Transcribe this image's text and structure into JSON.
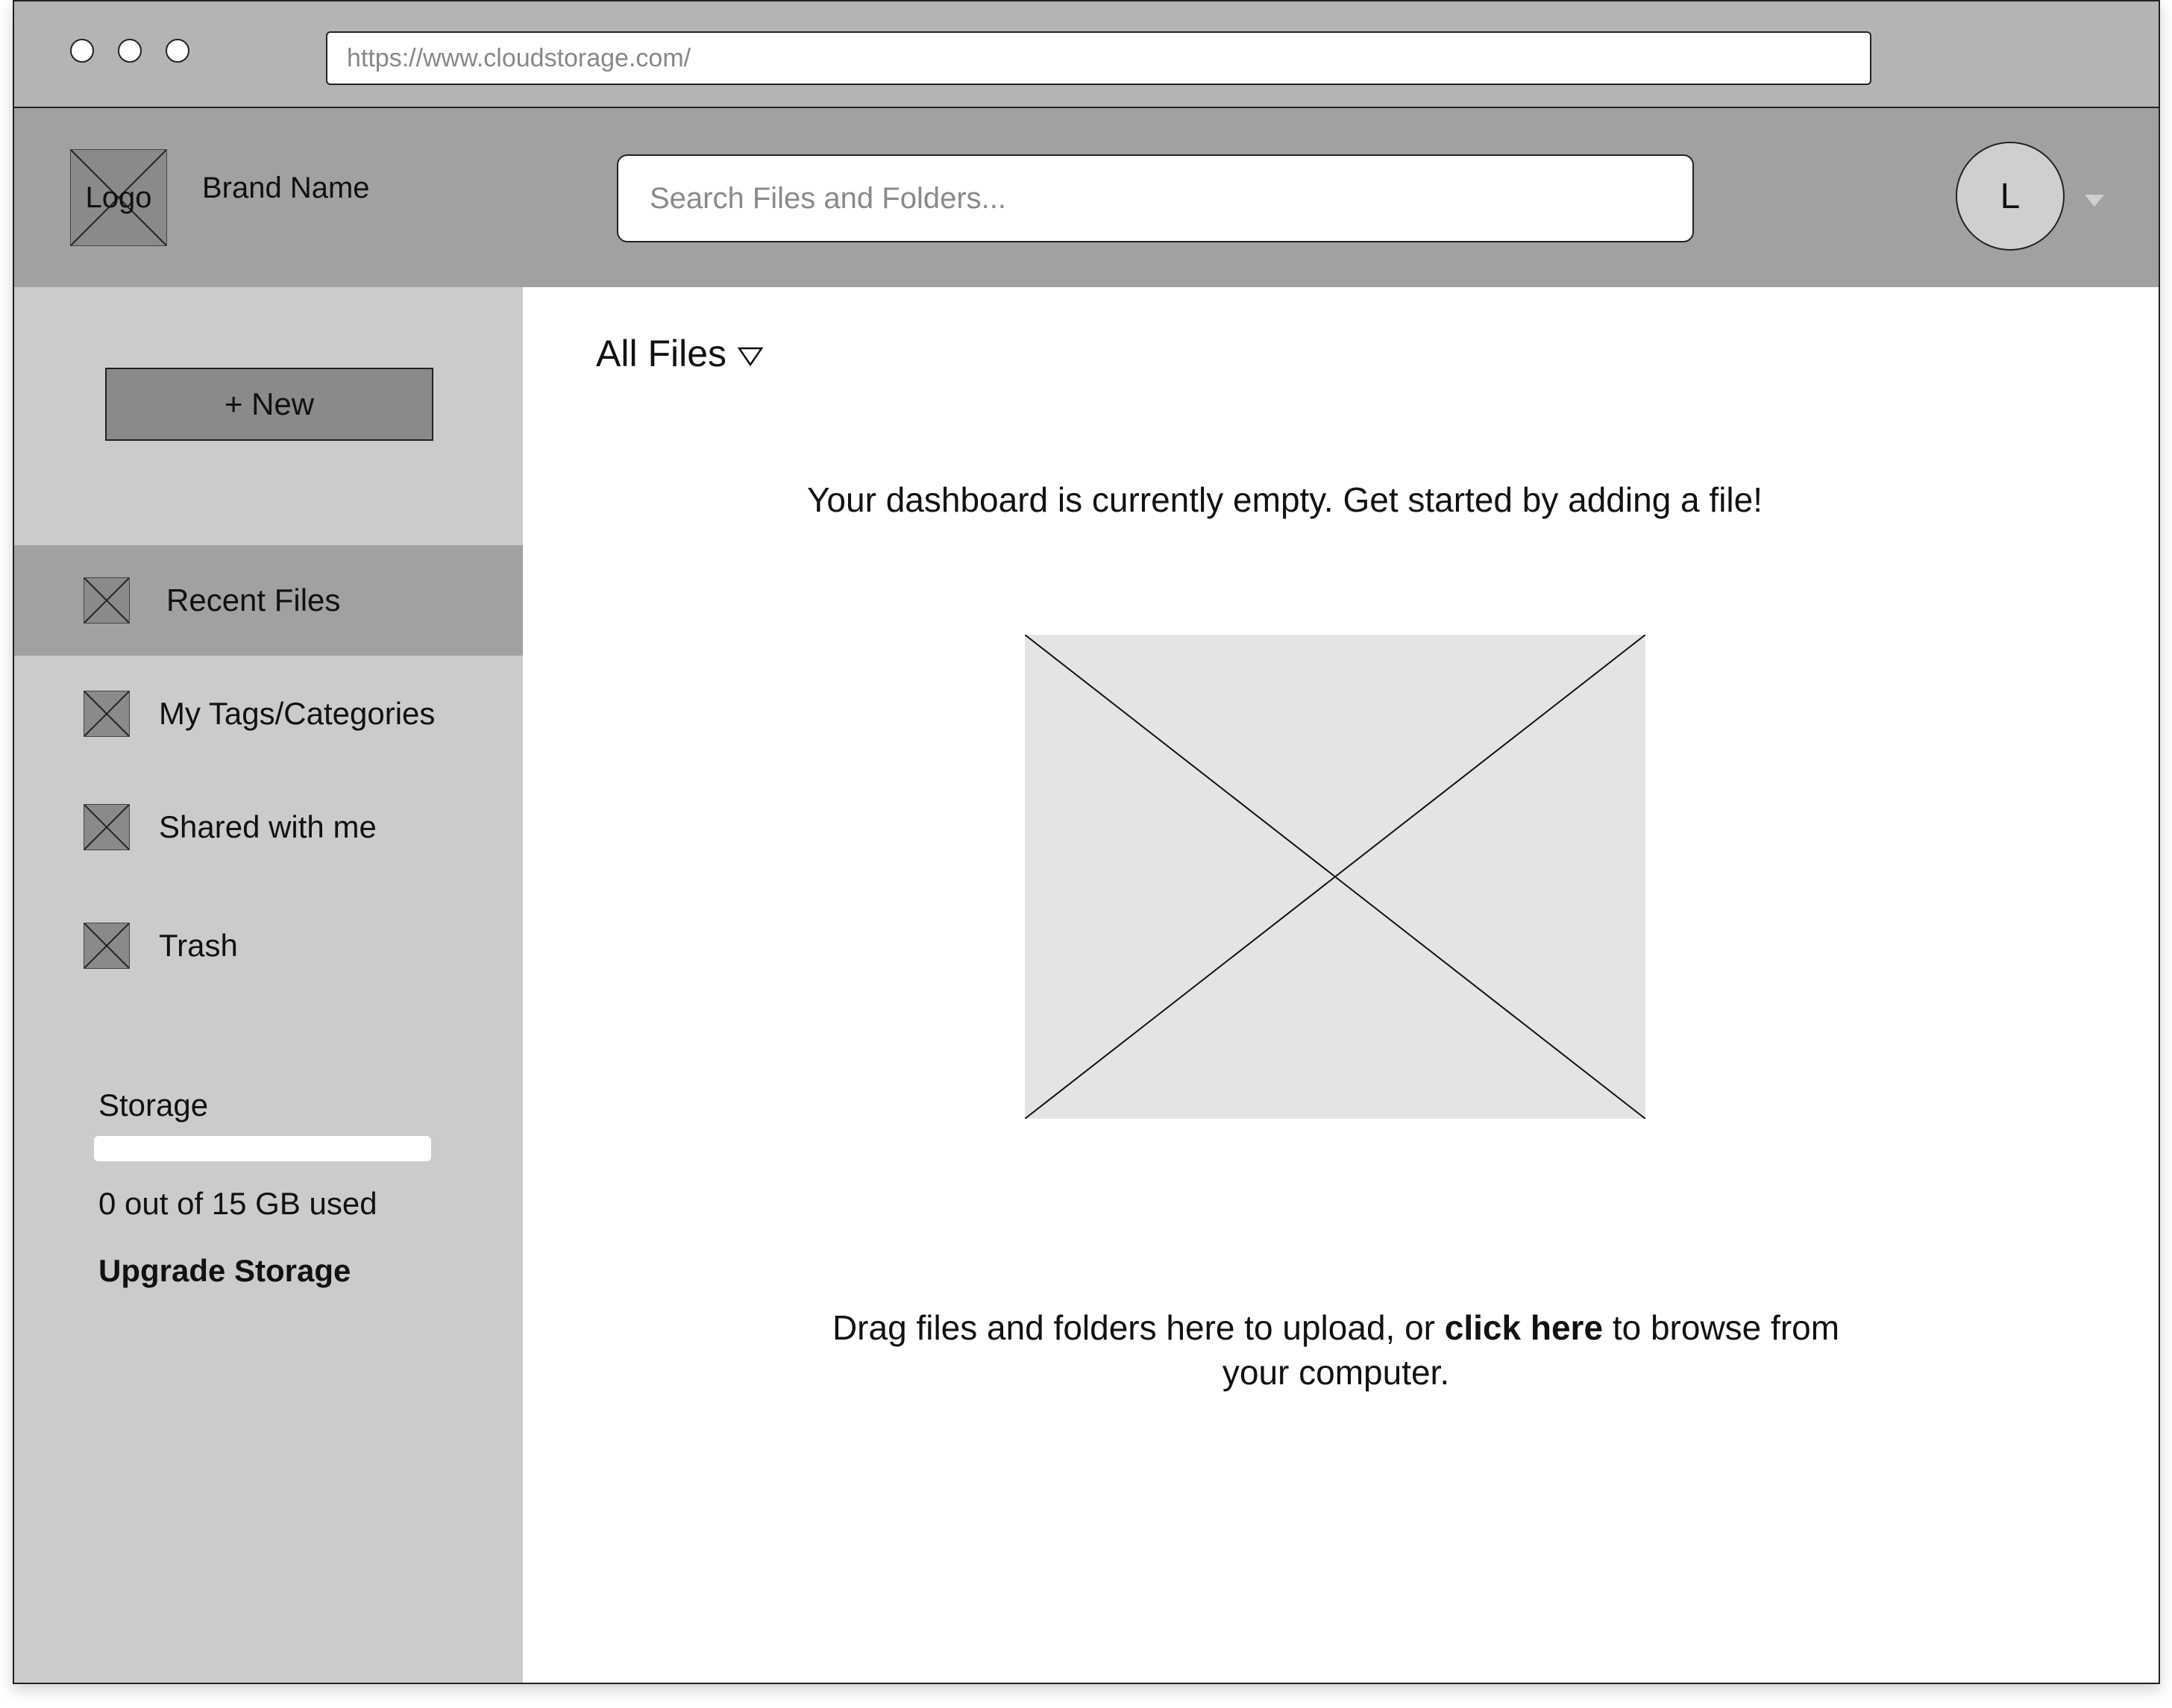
{
  "browser": {
    "url": "https://www.cloudstorage.com/"
  },
  "header": {
    "logo_text": "Logo",
    "brand_name": "Brand Name",
    "search_placeholder": "Search Files and Folders...",
    "avatar_initial": "L"
  },
  "sidebar": {
    "new_button": "+ New",
    "items": [
      {
        "label": "Recent Files",
        "active": true,
        "icon": "image-placeholder-icon"
      },
      {
        "label": "My Tags/Categories",
        "active": false,
        "icon": "image-placeholder-icon"
      },
      {
        "label": "Shared with me",
        "active": false,
        "icon": "image-placeholder-icon"
      },
      {
        "label": "Trash",
        "active": false,
        "icon": "image-placeholder-icon"
      }
    ],
    "storage": {
      "label": "Storage",
      "used_fraction": 0,
      "usage_text": "0 out of 15 GB used",
      "upgrade_link": "Upgrade Storage"
    }
  },
  "main": {
    "folder_selector": "All Files",
    "empty_message": "Your dashboard is currently empty. Get started by adding a file!",
    "drop_hint_before": "Drag files and folders here to upload, or",
    "drop_hint_link": "click here",
    "drop_hint_after": "to browse from your computer."
  },
  "colors": {
    "chrome": "#b4b4b4",
    "header": "#a1a1a1",
    "sidebar": "#cbcbcb",
    "active_item": "#a1a1a1",
    "new_button": "#8c8989"
  }
}
